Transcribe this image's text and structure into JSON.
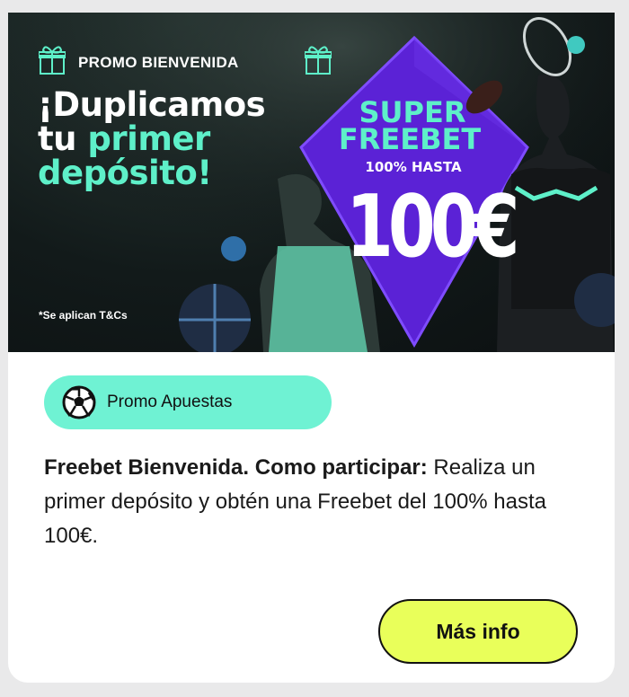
{
  "banner": {
    "kicker": "PROMO BIENVENIDA",
    "headline_line1": "¡Duplicamos",
    "headline_line2_a": "tu ",
    "headline_line2_b": "primer",
    "headline_line3": "depósito!",
    "super_line1": "SUPER",
    "super_line2": "FREEBET",
    "hasta": "100% HASTA",
    "amount": "100€",
    "terms": "*Se aplican T&Cs"
  },
  "category": {
    "label": "Promo Apuestas",
    "icon": "soccer-ball-icon"
  },
  "description": {
    "bold": "Freebet Bienvenida. Como participar:",
    "text": " Realiza un primer depósito y obtén una Freebet del 100% hasta 100€."
  },
  "button": {
    "label": "Más info"
  },
  "colors": {
    "accent": "#5ef0c9",
    "chip": "#6ff2d3",
    "diamond": "#5b22d6",
    "button": "#e9ff5a"
  }
}
